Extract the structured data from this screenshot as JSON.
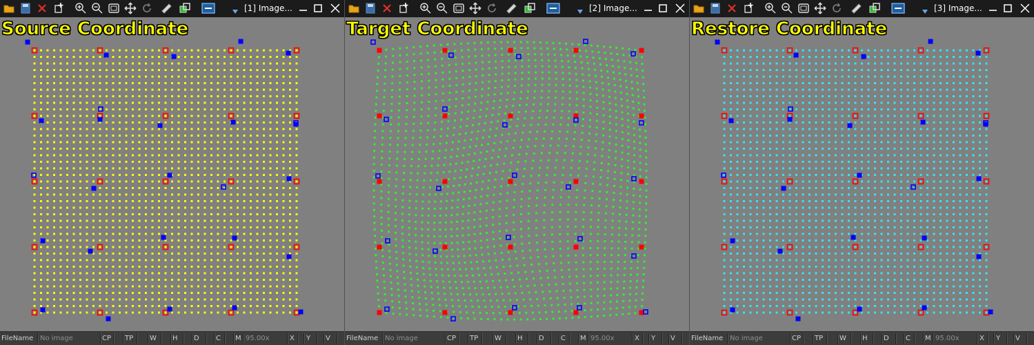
{
  "colors": {
    "panel_bg": "#808080",
    "toolbar_bg": "#1b1b1b",
    "status_bg": "#3c3c3c",
    "heading": "#ffff00",
    "control_point_red": "#ff0000",
    "control_point_blue": "#0000ff",
    "grid_source": "#ffff00",
    "grid_target": "#33ee33",
    "grid_restore": "#33e6f0"
  },
  "toolbar_icons": [
    "open-folder-icon",
    "save-icon",
    "delete-icon",
    "add-point-icon",
    "zoom-in-icon",
    "zoom-out-icon",
    "fit-window-icon",
    "pan-icon",
    "rotate-icon",
    "ruler-icon",
    "overlay-icon",
    "view-mode-icon"
  ],
  "panels": [
    {
      "window_title": "[1] Image...",
      "heading": "Source Coordinate",
      "grid_color": "#ffff00",
      "warp": 0
    },
    {
      "window_title": "[2] Image...",
      "heading": "Target Coordinate",
      "grid_color": "#33ee33",
      "warp": 1
    },
    {
      "window_title": "[3] Image...",
      "heading": "Restore Coordinate",
      "grid_color": "#33e6f0",
      "warp": 0
    }
  ],
  "status_bar": {
    "filename_label": "FileName",
    "filename_value": "No image",
    "cp": "CP",
    "tp": "TP",
    "w": "W",
    "h": "H",
    "d": "D",
    "c": "C",
    "m": "M",
    "zoom": "95.00x",
    "x": "X",
    "y": "Y",
    "v": "V"
  }
}
